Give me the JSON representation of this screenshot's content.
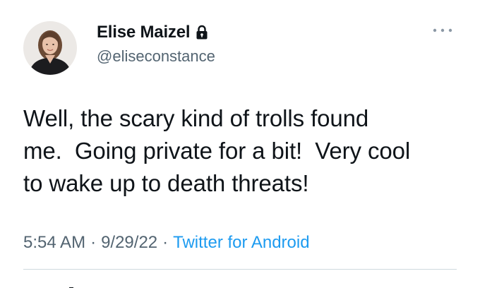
{
  "author": {
    "display_name": "Elise Maizel",
    "handle": "@eliseconstance",
    "protected_icon": "lock-icon",
    "avatar_icon": "avatar"
  },
  "menu": {
    "icon": "more-horizontal-icon"
  },
  "tweet": {
    "text": "Well, the scary kind of trolls found\nme.  Going private for a bit!  Very cool\nto wake up to death threats!"
  },
  "meta": {
    "time": "5:54 AM",
    "separator": "·",
    "date": "9/29/22",
    "source": "Twitter for Android"
  },
  "colors": {
    "text": "#0f1419",
    "secondary": "#536471",
    "link": "#1d9bf0",
    "divider": "#cfd9de"
  }
}
